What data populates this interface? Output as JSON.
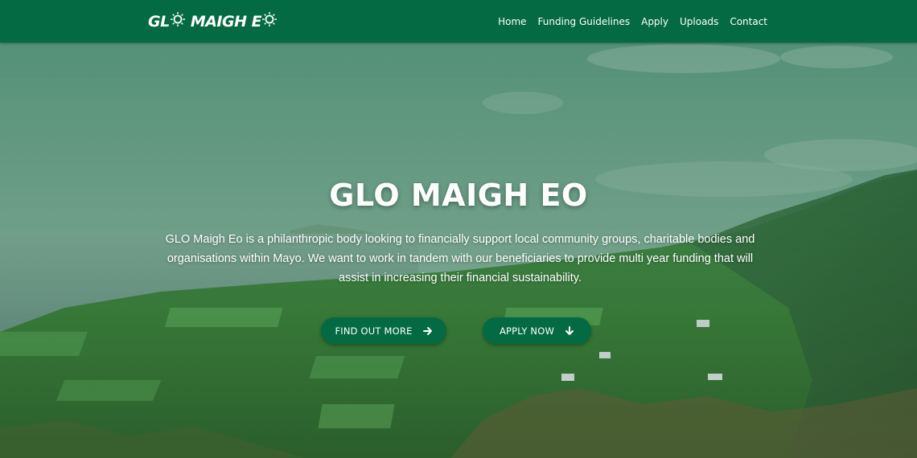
{
  "header": {
    "logo_text": "GLO MAIGH EO",
    "nav": [
      {
        "label": "Home"
      },
      {
        "label": "Funding Guidelines"
      },
      {
        "label": "Apply"
      },
      {
        "label": "Uploads"
      },
      {
        "label": "Contact"
      }
    ]
  },
  "hero": {
    "title": "GLO MAIGH EO",
    "description": "GLO Maigh Eo is a philanthropic body looking to financially support local community groups, charitable bodies and organisations within Mayo. We want to work in tandem with our beneficiaries to provide multi year funding that will assist in increasing their financial sustainability.",
    "buttons": [
      {
        "label": "FIND OUT MORE",
        "icon": "arrow-right-icon"
      },
      {
        "label": "APPLY NOW",
        "icon": "arrow-down-icon"
      }
    ],
    "background": "landscape-photo"
  },
  "colors": {
    "brand_green": "#036a43",
    "text": "#ffffff"
  }
}
